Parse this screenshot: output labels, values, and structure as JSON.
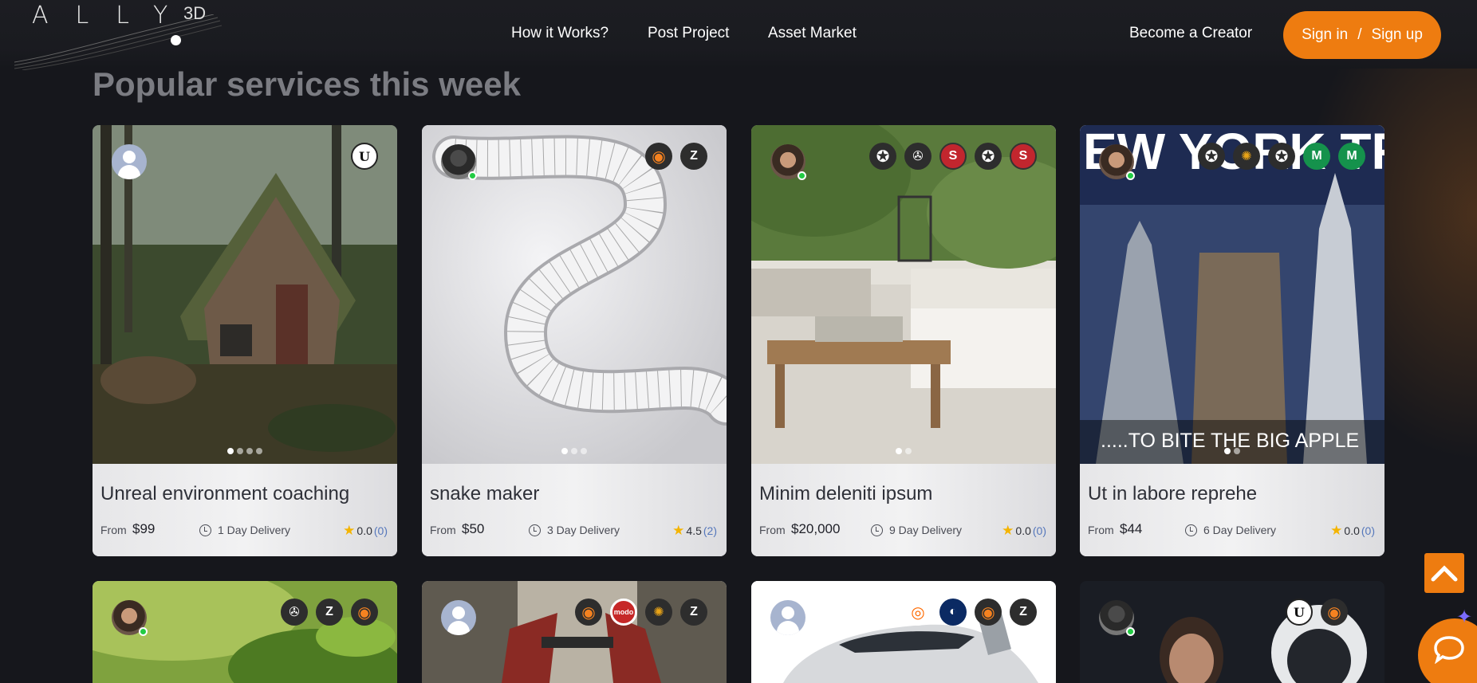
{
  "header": {
    "logo": {
      "text": "ALLY",
      "superscript": "3D"
    },
    "nav": [
      "How it Works?",
      "Post Project",
      "Asset Market"
    ],
    "become_creator": "Become a Creator",
    "sign_in": "Sign in",
    "separator": "/",
    "sign_up": "Sign up"
  },
  "section": {
    "title": "Popular services this week"
  },
  "cards": [
    {
      "title": "Unreal environment coaching",
      "from": "From",
      "price": "$99",
      "delivery": "1 Day Delivery",
      "rating": "0.0",
      "count": "(0)",
      "avatar": "default",
      "online": false,
      "software": [
        "unreal-icon"
      ],
      "slides": 4,
      "active": 0
    },
    {
      "title": "snake maker",
      "from": "From",
      "price": "$50",
      "delivery": "3 Day Delivery",
      "rating": "4.5",
      "count": "(2)",
      "avatar": "dark",
      "online": true,
      "software": [
        "blender-icon",
        "zbrush-icon"
      ],
      "slides": 3,
      "active": 0
    },
    {
      "title": "Minim deleniti ipsum",
      "from": "From",
      "price": "$20,000",
      "delivery": "9 Day Delivery",
      "rating": "0.0",
      "count": "(0)",
      "avatar": "face",
      "online": true,
      "software": [
        "unity-icon",
        "maya-icon",
        "substance-icon",
        "unity-icon",
        "substance-icon"
      ],
      "slides": 2,
      "active": 0
    },
    {
      "title": "Ut in labore reprehe",
      "from": "From",
      "price": "$44",
      "delivery": "6 Day Delivery",
      "rating": "0.0",
      "count": "(0)",
      "avatar": "face",
      "online": true,
      "software": [
        "unity-icon",
        "keyshot-icon",
        "unity-icon",
        "m-icon",
        "m-icon"
      ],
      "slides": 2,
      "active": 0,
      "banner_top": "EW YORK TR",
      "banner_bottom": ".....TO BITE THE BIG APPLE"
    }
  ],
  "row2": [
    {
      "avatar": "face",
      "online": true,
      "software": [
        "maya-icon",
        "zbrush-icon",
        "blender-icon"
      ]
    },
    {
      "avatar": "default",
      "online": false,
      "software": [
        "blender-icon",
        "modo-icon",
        "keyshot-icon",
        "zbrush-icon"
      ]
    },
    {
      "avatar": "default",
      "online": false,
      "software": [
        "houdini-icon",
        "c4d-icon",
        "blender-icon",
        "zbrush-icon"
      ]
    },
    {
      "avatar": "dark",
      "online": true,
      "software": [
        "unreal-icon",
        "blender-icon"
      ]
    }
  ],
  "icon_glyphs": {
    "unreal-icon": "U",
    "blender-icon": "◉",
    "zbrush-icon": "Z",
    "unity-icon": "✪",
    "maya-icon": "✇",
    "substance-icon": "S",
    "keyshot-icon": "✺",
    "m-icon": "M",
    "modo-icon": "modo",
    "houdini-icon": "◎",
    "c4d-icon": "◐"
  },
  "colors": {
    "accent": "#ee7c10",
    "background": "#16171c",
    "online": "#22cc44",
    "star": "#f4b400"
  }
}
